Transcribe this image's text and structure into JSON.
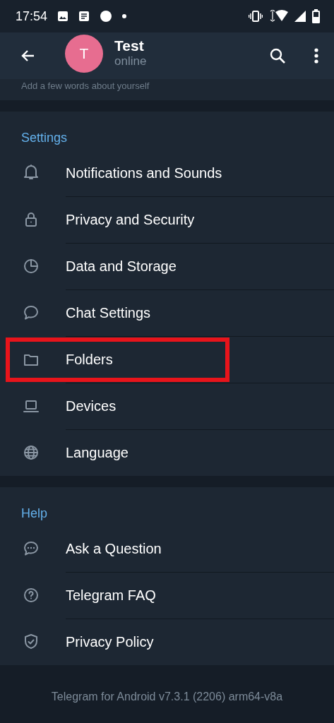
{
  "status_bar": {
    "time": "17:54"
  },
  "app_bar": {
    "avatar_letter": "T",
    "name": "Test",
    "status": "online"
  },
  "bio_hint": "Add a few words about yourself",
  "sections": [
    {
      "title": "Settings",
      "items": [
        {
          "label": "Notifications and Sounds",
          "highlighted": false
        },
        {
          "label": "Privacy and Security",
          "highlighted": false
        },
        {
          "label": "Data and Storage",
          "highlighted": false
        },
        {
          "label": "Chat Settings",
          "highlighted": false
        },
        {
          "label": "Folders",
          "highlighted": true
        },
        {
          "label": "Devices",
          "highlighted": false
        },
        {
          "label": "Language",
          "highlighted": false
        }
      ]
    },
    {
      "title": "Help",
      "items": [
        {
          "label": "Ask a Question",
          "highlighted": false
        },
        {
          "label": "Telegram FAQ",
          "highlighted": false
        },
        {
          "label": "Privacy Policy",
          "highlighted": false
        }
      ]
    }
  ],
  "footer": "Telegram for Android v7.3.1 (2206) arm64-v8a"
}
